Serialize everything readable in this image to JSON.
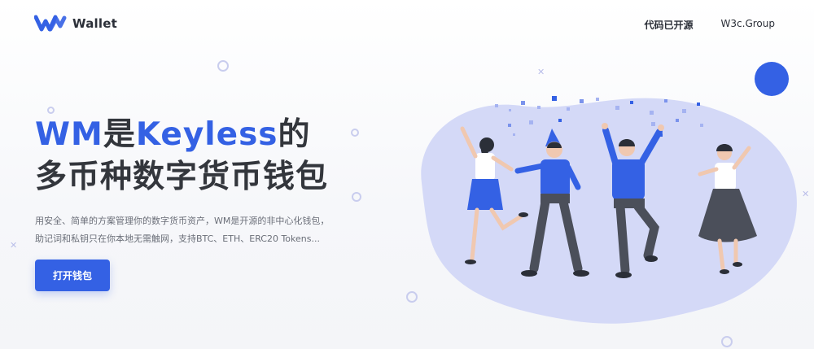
{
  "brand": {
    "name": "Wallet",
    "color": "#3461e4"
  },
  "nav": {
    "items": [
      {
        "label": "代码已开源"
      },
      {
        "label": "W3c.Group"
      }
    ]
  },
  "hero": {
    "title_line1_accent_a": "WM",
    "title_line1_plain": "是",
    "title_line1_accent_b": "Keyless",
    "title_line1_tail": "的",
    "title_line2": "多币种数字货币钱包",
    "desc_line1": "用安全、简单的方案管理你的数字货币资产，WM是开源的非中心化钱包，",
    "desc_line2": "助记词和私钥只在你本地无需触网，支持BTC、ETH、ERC20 Tokens...",
    "cta_label": "打开钱包"
  },
  "colors": {
    "accent": "#3461e4",
    "blob": "#d4d9f7",
    "text": "#33363c"
  },
  "illustration": {
    "icon": "celebrating-people-illustration"
  }
}
